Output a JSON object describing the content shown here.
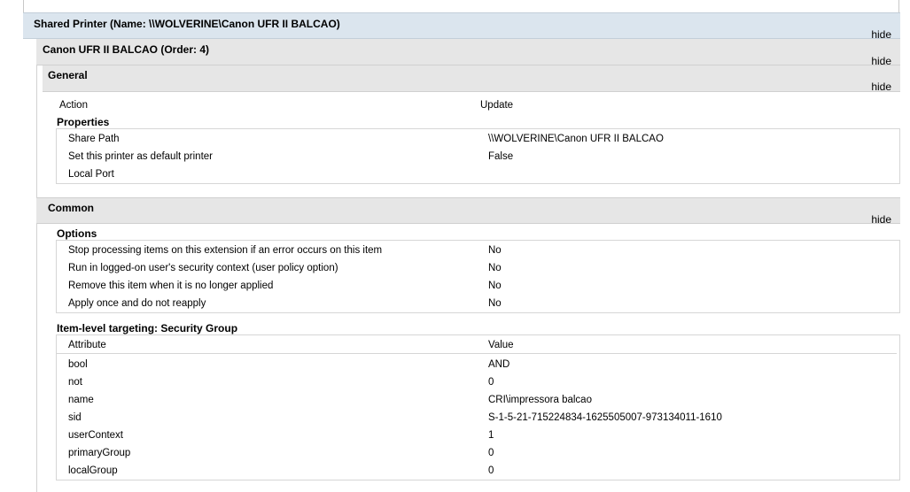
{
  "shared_printer": {
    "title": "Shared Printer (Name: \\\\WOLVERINE\\Canon UFR II BALCAO)",
    "hide": "hide"
  },
  "printer": {
    "title": "Canon UFR II BALCAO (Order: 4)",
    "hide": "hide"
  },
  "general": {
    "title": "General",
    "hide": "hide",
    "action_label": "Action",
    "action_value": "Update",
    "properties_title": "Properties",
    "properties": [
      {
        "label": "Share Path",
        "value": "\\\\WOLVERINE\\Canon UFR II BALCAO"
      },
      {
        "label": "Set this printer as default printer",
        "value": "False"
      },
      {
        "label": "Local Port",
        "value": ""
      }
    ]
  },
  "common": {
    "title": "Common",
    "hide": "hide",
    "options_title": "Options",
    "options": [
      {
        "label": "Stop processing items on this extension if an error occurs on this item",
        "value": "No"
      },
      {
        "label": "Run in logged-on user's security context (user policy option)",
        "value": "No"
      },
      {
        "label": "Remove this item when it is no longer applied",
        "value": "No"
      },
      {
        "label": "Apply once and do not reapply",
        "value": "No"
      }
    ],
    "targeting_title": "Item-level targeting: Security Group",
    "targeting_header": {
      "attribute": "Attribute",
      "value": "Value"
    },
    "targeting": [
      {
        "label": "bool",
        "value": "AND"
      },
      {
        "label": "not",
        "value": "0"
      },
      {
        "label": "name",
        "value": "CRI\\impressora balcao"
      },
      {
        "label": "sid",
        "value": "S-1-5-21-715224834-1625505007-973134011-1610"
      },
      {
        "label": "userContext",
        "value": "1"
      },
      {
        "label": "primaryGroup",
        "value": "0"
      },
      {
        "label": "localGroup",
        "value": "0"
      }
    ]
  }
}
